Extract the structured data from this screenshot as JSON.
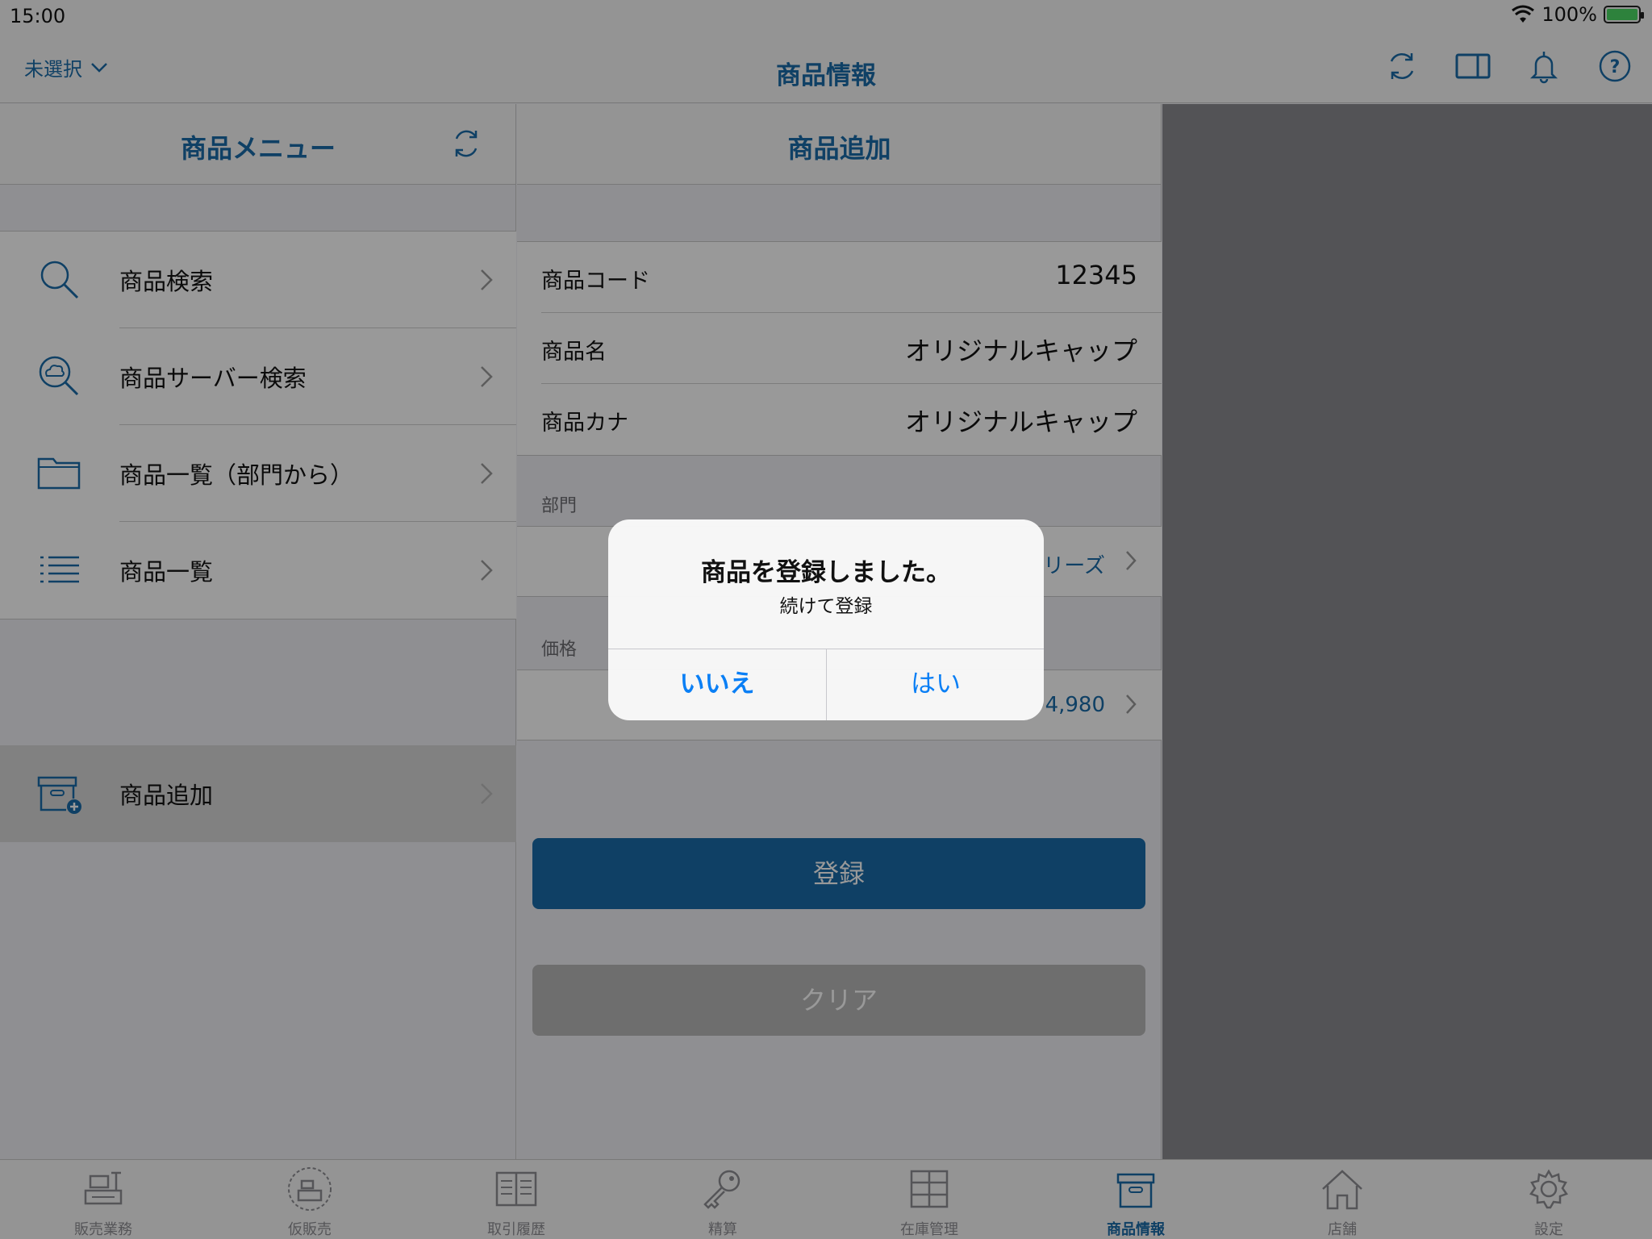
{
  "status": {
    "time": "15:00",
    "battery": "100%"
  },
  "nav": {
    "selector": "未選択",
    "title": "商品情報"
  },
  "left": {
    "title": "商品メニュー",
    "items": [
      {
        "label": "商品検索",
        "icon": "magnifier-icon"
      },
      {
        "label": "商品サーバー検索",
        "icon": "cloud-search-icon"
      },
      {
        "label": "商品一覧（部門から）",
        "icon": "folder-icon"
      },
      {
        "label": "商品一覧",
        "icon": "list-icon"
      }
    ],
    "add": {
      "label": "商品追加",
      "icon": "box-add-icon"
    }
  },
  "form": {
    "title": "商品追加",
    "code_label": "商品コード",
    "code_value": "12345",
    "name_label": "商品名",
    "name_value": "オリジナルキャップ",
    "kana_label": "商品カナ",
    "kana_value": "オリジナルキャップ",
    "dept_label": "部門",
    "dept_value": "リーズ",
    "price_label": "価格",
    "price_value": "4,980",
    "register": "登録",
    "clear": "クリア"
  },
  "tabs": [
    {
      "label": "販売業務",
      "icon": "register-icon"
    },
    {
      "label": "仮販売",
      "icon": "temp-sale-icon"
    },
    {
      "label": "取引履歴",
      "icon": "history-icon"
    },
    {
      "label": "精算",
      "icon": "key-icon"
    },
    {
      "label": "在庫管理",
      "icon": "inventory-icon"
    },
    {
      "label": "商品情報",
      "icon": "product-box-icon",
      "active": true
    },
    {
      "label": "店舗",
      "icon": "store-icon"
    },
    {
      "label": "設定",
      "icon": "gear-icon"
    }
  ],
  "alert": {
    "title": "商品を登録しました。",
    "message": "続けて登録",
    "no": "いいえ",
    "yes": "はい"
  },
  "colors": {
    "accent": "#1a6ca8",
    "alert_button": "#0a7ff5"
  }
}
